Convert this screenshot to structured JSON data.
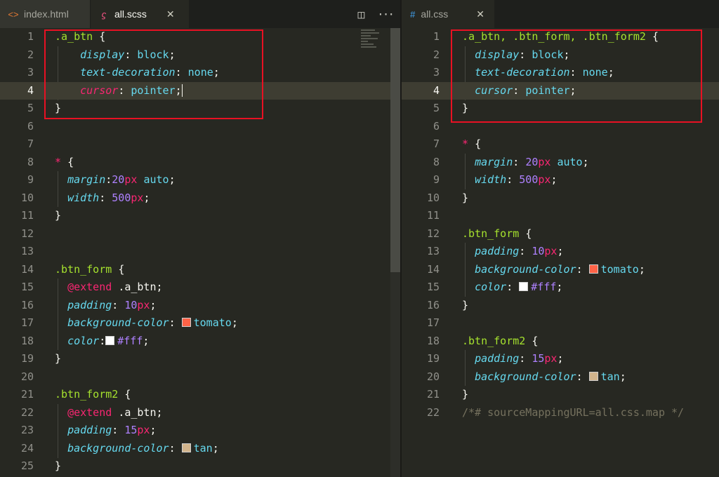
{
  "left_pane": {
    "tabs": [
      {
        "label": "index.html",
        "icon": "code-icon"
      },
      {
        "label": "all.scss",
        "icon": "sass-icon",
        "close": "✕"
      }
    ],
    "actions": {
      "split": "◫",
      "more": "···"
    },
    "line_numbers": [
      "1",
      "2",
      "3",
      "4",
      "5",
      "6",
      "7",
      "8",
      "9",
      "10",
      "11",
      "12",
      "13",
      "14",
      "15",
      "16",
      "17",
      "18",
      "19",
      "20",
      "21",
      "22",
      "23",
      "24",
      "25"
    ]
  },
  "right_pane": {
    "tabs": [
      {
        "label": "all.css",
        "icon": "hash-icon",
        "close": "✕"
      }
    ],
    "line_numbers": [
      "1",
      "2",
      "3",
      "4",
      "5",
      "6",
      "7",
      "8",
      "9",
      "10",
      "11",
      "12",
      "13",
      "14",
      "15",
      "16",
      "17",
      "18",
      "19",
      "20",
      "21",
      "22"
    ]
  },
  "scss": {
    "l1_sel": ".a_btn",
    "open": "{",
    "close": "}",
    "p_display": "display",
    "v_block": "block",
    "p_textdec": "text-decoration",
    "v_none": "none",
    "p_cursor": "cursor",
    "v_pointer": "pointer",
    "star": "*",
    "p_margin": "margin",
    "n_20": "20",
    "u_px": "px",
    "v_auto": "auto",
    "p_width": "width",
    "n_500": "500",
    "sel_form": ".btn_form",
    "at_extend": "@extend",
    "ext_target": ".a_btn",
    "p_padding": "padding",
    "n_10": "10",
    "n_15": "15",
    "p_bg": "background-color",
    "v_tomato": "tomato",
    "p_color": "color",
    "v_fff": "#fff",
    "sel_form2": ".btn_form2",
    "v_tan": "tan"
  },
  "css": {
    "l1_sel": ".a_btn, .btn_form, .btn_form2",
    "comment": "/*# sourceMappingURL=all.css.map */"
  },
  "colors": {
    "tomato": "#ff6347",
    "white": "#ffffff",
    "tan": "#d2b48c",
    "highlight": "#e81123"
  }
}
